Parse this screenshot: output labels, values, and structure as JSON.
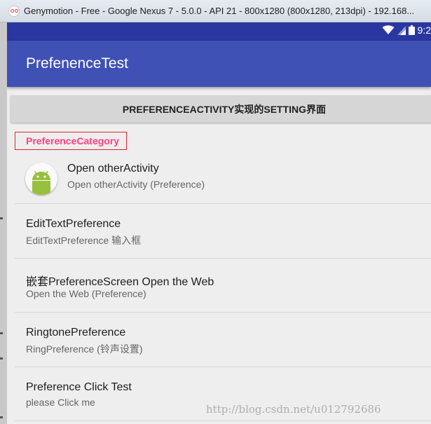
{
  "window": {
    "title": "Genymotion - Free - Google Nexus 7 - 5.0.0 - API 21 - 800x1280 (800x1280, 213dpi) - 192.168...",
    "logo_icon": "genymotion-logo-icon"
  },
  "statusbar": {
    "time": "9:2",
    "icons": [
      "wifi-icon",
      "signal-icon",
      "battery-icon"
    ]
  },
  "appbar": {
    "title": "PrefenenceTest"
  },
  "header_button": {
    "label": "PREFERENCEACTIVITY实现的SETTING界面"
  },
  "category": {
    "label": "PreferenceCategory"
  },
  "preferences": [
    {
      "title": "Open otherActivity",
      "summary": "Open otherActivity (Preference)",
      "icon": "android-icon"
    },
    {
      "title": "EditTextPreference",
      "summary": "EditTextPreference 输入框"
    },
    {
      "title": "嵌套PreferenceScreen Open the Web",
      "summary": "Open the Web (Preference)"
    },
    {
      "title": "RingtonePreference",
      "summary": "RingPreference (铃声设置)"
    },
    {
      "title": "Preference Click Test",
      "summary": "please Click me"
    }
  ],
  "watermark": "http://blog.csdn.net/u012792686",
  "colors": {
    "statusbar": "#2a37a0",
    "appbar": "#3f51b5",
    "accent": "#ff4081",
    "highlight_border": "#e0262e",
    "android_green": "#97c03d"
  }
}
